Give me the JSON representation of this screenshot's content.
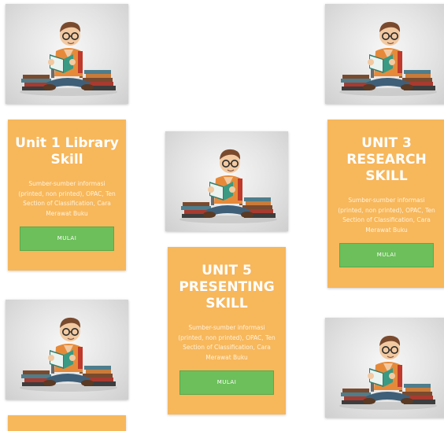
{
  "cards": [
    {
      "title": "Unit 1 Library Skill",
      "description": "Sumber-sumber informasi (printed, non printed), OPAC, Ten Section of Classification, Cara Merawat Buku",
      "button_label": "MULAI"
    },
    {
      "title": "UNIT 3 RESEARCH SKILL",
      "description": "Sumber-sumber informasi (printed, non printed), OPAC, Ten Section of Classification, Cara Merawat Buku",
      "button_label": "MULAI"
    },
    {
      "title": "UNIT 5 PRESENTING SKILL",
      "description": "Sumber-sumber informasi (printed, non printed), OPAC, Ten Section of Classification, Cara Merawat Buku",
      "button_label": "MULAI"
    }
  ],
  "colors": {
    "card_background": "#f7b75b",
    "button_background": "#6cbf5b",
    "text": "#ffffff"
  },
  "illustration": {
    "icon": "student-reading-books-illustration"
  }
}
